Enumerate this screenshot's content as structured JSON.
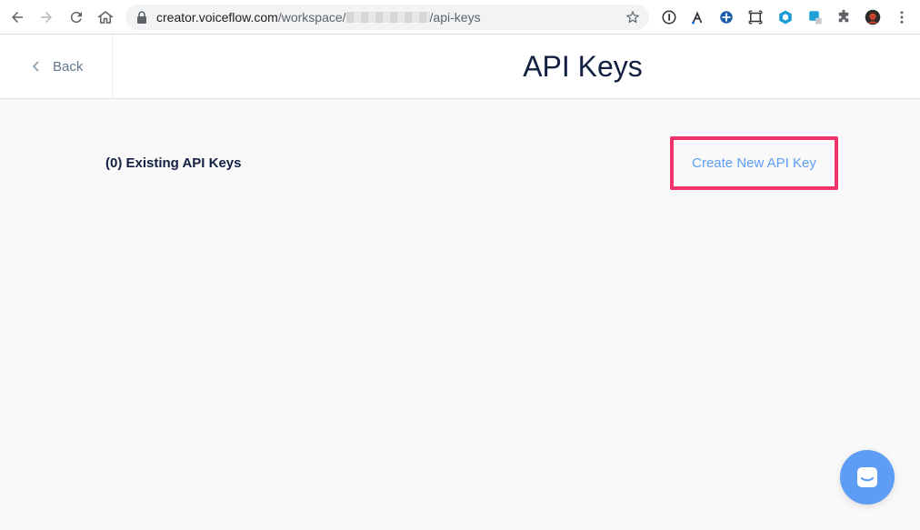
{
  "browser": {
    "url_host": "creator.voiceflow.com",
    "url_path_prefix": "/workspace/",
    "url_path_suffix": "/api-keys",
    "icons": [
      "back-arrow-icon",
      "forward-arrow-icon",
      "reload-icon",
      "home-icon",
      "lock-icon",
      "star-icon",
      "password-manager-icon",
      "branch-extension-icon",
      "extension-icon",
      "screenshot-icon",
      "extension-icon-2",
      "extension-icon-3",
      "puzzle-icon",
      "profile-avatar",
      "menu-dots-icon"
    ]
  },
  "header": {
    "back_label": "Back",
    "title": "API Keys"
  },
  "main": {
    "existing_keys_label": "(0) Existing API Keys",
    "create_button_label": "Create New API Key"
  },
  "colors": {
    "accent": "#5d9df5",
    "highlight": "#f0346a",
    "title": "#132042"
  }
}
